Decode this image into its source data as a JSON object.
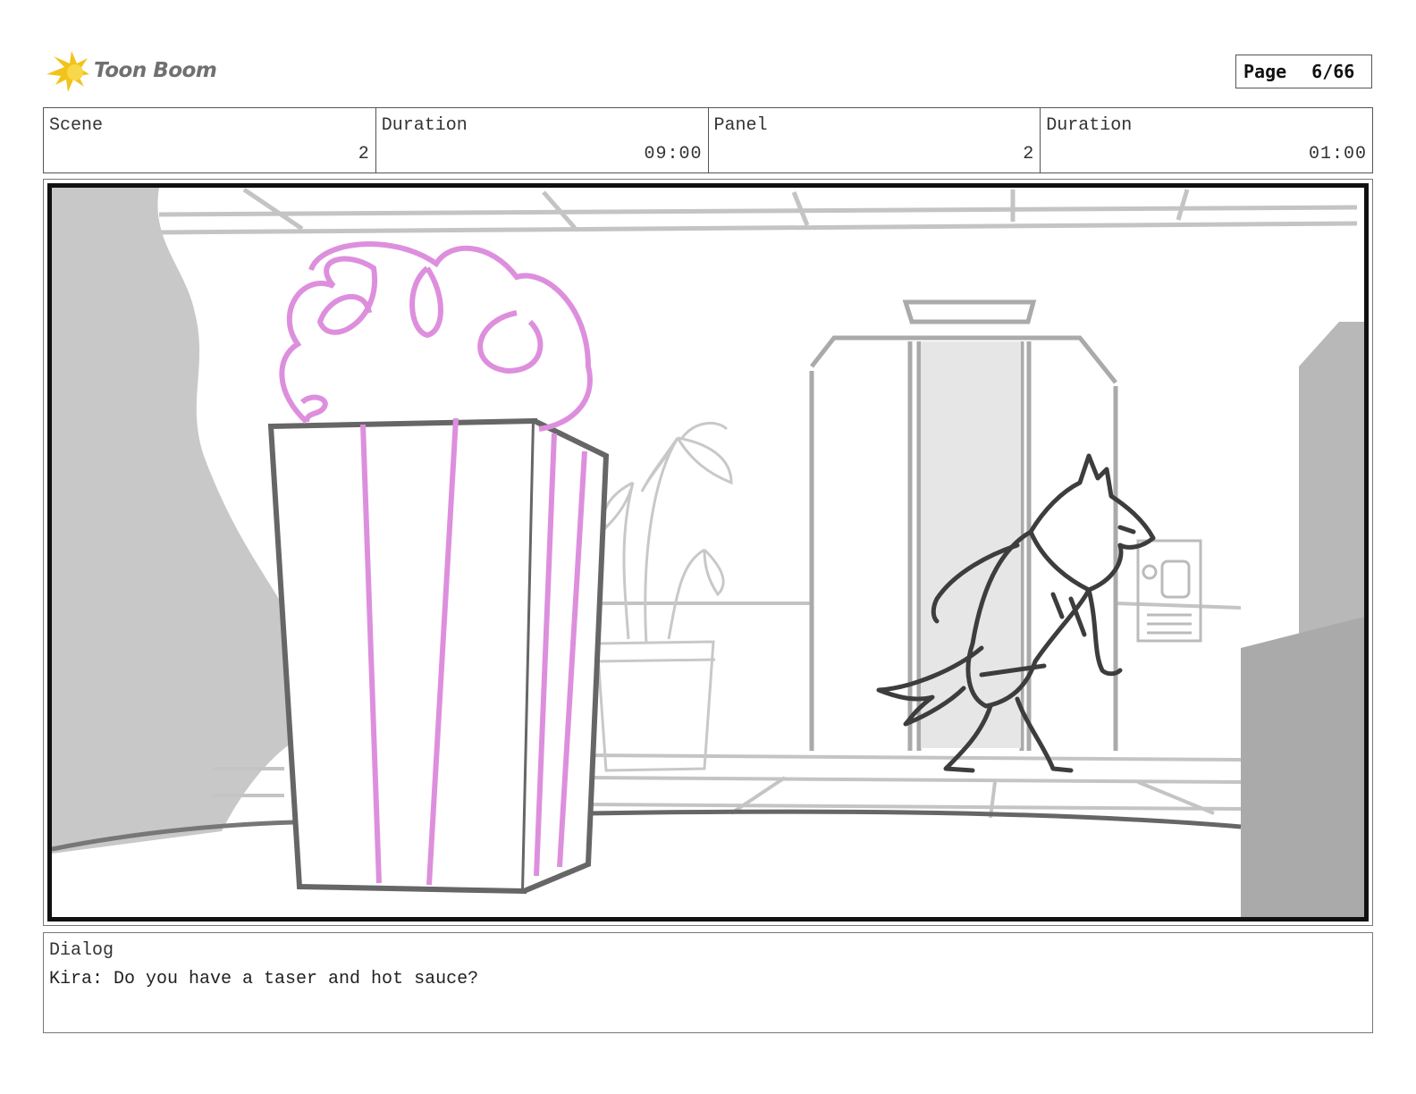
{
  "brand": {
    "name": "Toon Boom",
    "logo_icon": "toon-boom-logo-icon"
  },
  "page": {
    "label": "Page",
    "value": "6/66"
  },
  "header": {
    "scene_label": "Scene",
    "scene_value": "2",
    "scene_duration_label": "Duration",
    "scene_duration_value": "09:00",
    "panel_label": "Panel",
    "panel_value": "2",
    "panel_duration_label": "Duration",
    "panel_duration_value": "01:00"
  },
  "dialog": {
    "label": "Dialog",
    "text": "Kira: Do you have a taser and hot sauce?"
  },
  "colors": {
    "popcorn_stripe": "#dd8fdd",
    "sketch_dark": "#444444",
    "sketch_light": "#bdbdbd",
    "logo_yellow": "#f2c31b"
  }
}
